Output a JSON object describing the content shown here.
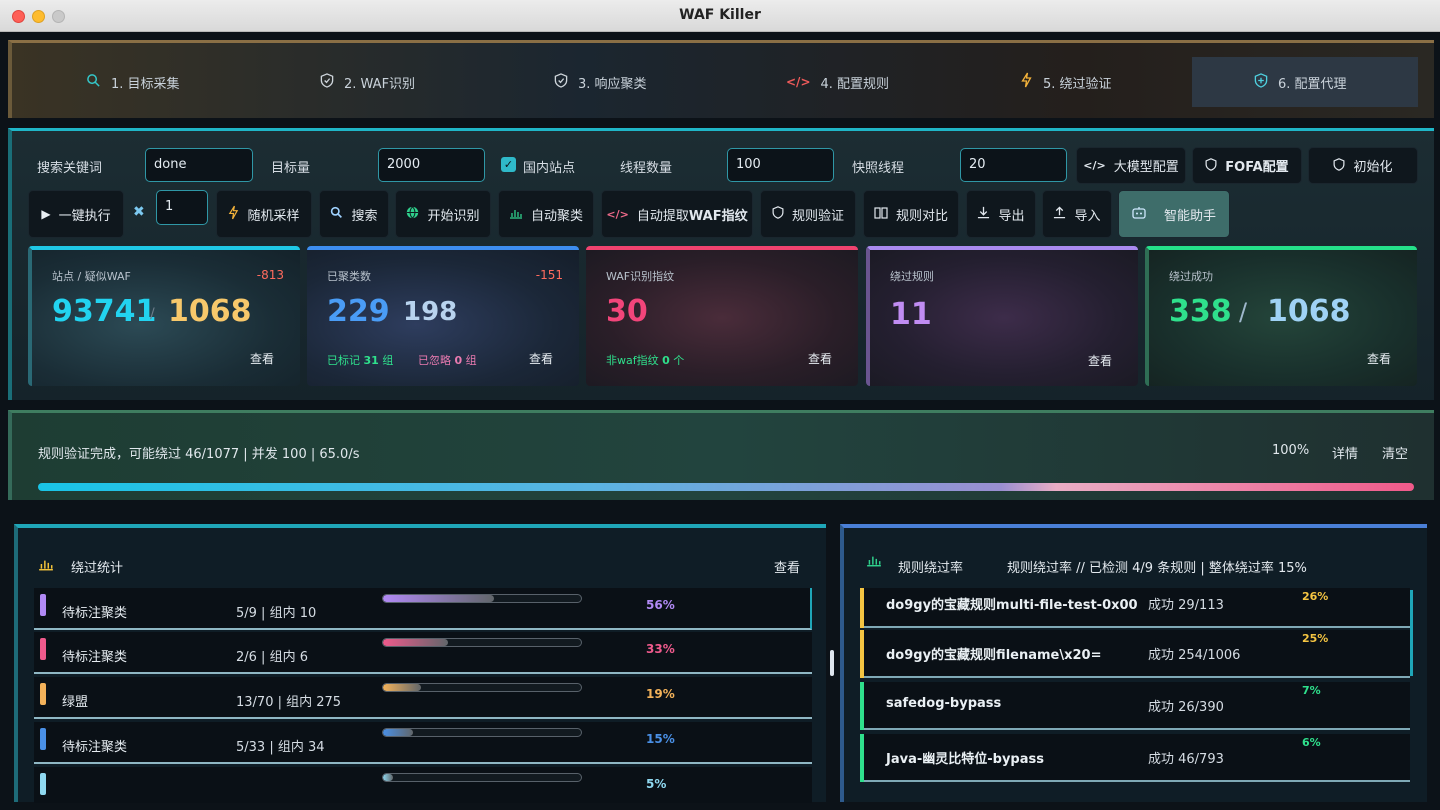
{
  "window": {
    "title": "WAF Killer"
  },
  "nav": {
    "items": [
      {
        "label": "1. 目标采集",
        "icon": "search-icon"
      },
      {
        "label": "2. WAF识别",
        "icon": "shield-check-icon"
      },
      {
        "label": "3. 响应聚类",
        "icon": "shield-check-icon"
      },
      {
        "label": "4. 配置规则",
        "icon": "code-icon"
      },
      {
        "label": "5. 绕过验证",
        "icon": "lightning-icon"
      },
      {
        "label": "6. 配置代理",
        "icon": "shield-plus-icon"
      }
    ],
    "active_index": 5
  },
  "controls": {
    "keyword_label": "搜索关键词",
    "keyword_value": "done",
    "target_label": "目标量",
    "target_value": "2000",
    "domestic_label": "国内站点",
    "domestic_checked": true,
    "threads_label": "线程数量",
    "threads_value": "100",
    "snapshot_label": "快照线程",
    "snapshot_value": "20",
    "llm_config": "大模型配置",
    "fofa_config": "FOFA配置",
    "init": "初始化",
    "run_all": "一键执行",
    "repeat_value": "1",
    "random_sample": "随机采样",
    "search": "搜索",
    "start_identify": "开始识别",
    "auto_cluster": "自动聚类",
    "auto_extract_prefix": "自动提取",
    "auto_extract_bold": "WAF指纹",
    "rule_verify": "规则验证",
    "rule_compare": "规则对比",
    "export": "导出",
    "import": "导入",
    "assistant": "智能助手"
  },
  "cards": [
    {
      "caption": "站点 / 疑似WAF",
      "delta": "-813",
      "value_a": "93741",
      "sep": "/",
      "value_b": "1068",
      "view": "查看",
      "accent": "#1fc8e6"
    },
    {
      "caption": "已聚类数",
      "delta": "-151",
      "value_a": "229",
      "value_b": "198",
      "marked_label": "已标记",
      "marked_value": "31",
      "marked_unit": "组",
      "ignored_label": "已忽略",
      "ignored_value": "0",
      "ignored_unit": "组",
      "view": "查看",
      "accent": "#3d8ef0"
    },
    {
      "caption": "WAF识别指纹",
      "value_a": "30",
      "sub_label": "非waf指纹",
      "sub_value": "0",
      "sub_unit": "个",
      "view": "查看",
      "accent": "#f0436f"
    },
    {
      "caption": "绕过规则",
      "value_a": "11",
      "view": "查看",
      "accent": "#a98bf0"
    },
    {
      "caption": "绕过成功",
      "value_a": "338",
      "sep": "/",
      "value_b": "1068",
      "view": "查看",
      "accent": "#25e08a"
    }
  ],
  "progress": {
    "status": "规则验证完成，可能绕过 46/1077 | 并发 100 | 65.0/s",
    "percent_text": "100%",
    "percent": 100,
    "details": "详情",
    "clear": "清空"
  },
  "bypass_stats": {
    "title": "绕过统计",
    "view": "查看",
    "rows": [
      {
        "name": "待标注聚类",
        "count": "5/9 | 组内 10",
        "pct_text": "56%",
        "pct": 56,
        "color": "#b18af5"
      },
      {
        "name": "待标注聚类",
        "count": "2/6 | 组内 6",
        "pct_text": "33%",
        "pct": 33,
        "color": "#ef5a8c"
      },
      {
        "name": "绿盟",
        "count": "13/70 | 组内 275",
        "pct_text": "19%",
        "pct": 19,
        "color": "#f3b25a"
      },
      {
        "name": "待标注聚类",
        "count": "5/33 | 组内 34",
        "pct_text": "15%",
        "pct": 15,
        "color": "#4a90e6"
      },
      {
        "name": "",
        "count": "",
        "pct_text": "5%",
        "pct": 5,
        "color": "#8fd8f0"
      }
    ]
  },
  "rule_rate": {
    "title": "规则绕过率",
    "summary": "规则绕过率 // 已检测 4/9 条规则 | 整体绕过率 15%",
    "rows": [
      {
        "name": "do9gy的宝藏规则multi-file-test-0x00",
        "success": "成功 29/113",
        "pct_text": "26%",
        "color": "#f5c542"
      },
      {
        "name": "do9gy的宝藏规则filename\\x20=",
        "success": "成功 254/1006",
        "pct_text": "25%",
        "color": "#f5c542"
      },
      {
        "name": "safedog-bypass",
        "success": "成功 26/390",
        "pct_text": "7%",
        "color": "#2fe08c"
      },
      {
        "name": "Java-幽灵比特位-bypass",
        "success": "成功 46/793",
        "pct_text": "6%",
        "color": "#2fe08c"
      }
    ]
  }
}
